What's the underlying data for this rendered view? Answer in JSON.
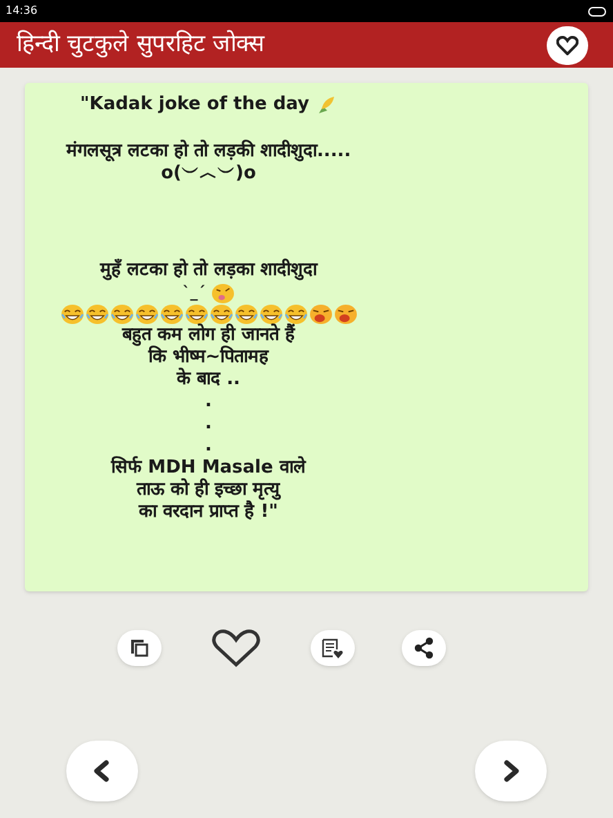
{
  "status_bar": {
    "time": "14:36"
  },
  "app_bar": {
    "title": "हिन्दी चुटकुले सुपरहिट जोक्स"
  },
  "joke": {
    "lines": [
      {
        "kind": "title",
        "text": "\"Kadak joke of the day"
      },
      {
        "kind": "gap"
      },
      {
        "kind": "text",
        "text": "मंगलसूत्र लटका हो तो लड़की शादीशुदा....."
      },
      {
        "kind": "text",
        "text": "o(︶︿︶)o"
      },
      {
        "kind": "gap"
      },
      {
        "kind": "gap"
      },
      {
        "kind": "gap"
      },
      {
        "kind": "text",
        "text": "मुहँ लटका हो तो लड़का शादीशुदा"
      },
      {
        "kind": "face",
        "text": "ˋ_ˊ"
      },
      {
        "kind": "emoji-row"
      },
      {
        "kind": "text",
        "text": "बहुत कम लोग ही जानते हैं"
      },
      {
        "kind": "text",
        "text": "कि भीष्म~पितामह"
      },
      {
        "kind": "text",
        "text": "के बाद .."
      },
      {
        "kind": "text",
        "text": "."
      },
      {
        "kind": "text",
        "text": "."
      },
      {
        "kind": "text",
        "text": "."
      },
      {
        "kind": "text",
        "text": "सिर्फ MDH Masale वाले"
      },
      {
        "kind": "text",
        "text": "ताऊ को ही इच्छा मृत्यु"
      },
      {
        "kind": "text",
        "text": "का वरदान प्राप्त है !\""
      }
    ]
  },
  "actions": [
    {
      "kind": "copy"
    },
    {
      "kind": "favorite"
    },
    {
      "kind": "save"
    },
    {
      "kind": "share"
    }
  ],
  "nav": [
    {
      "kind": "previous"
    },
    {
      "kind": "next"
    }
  ]
}
